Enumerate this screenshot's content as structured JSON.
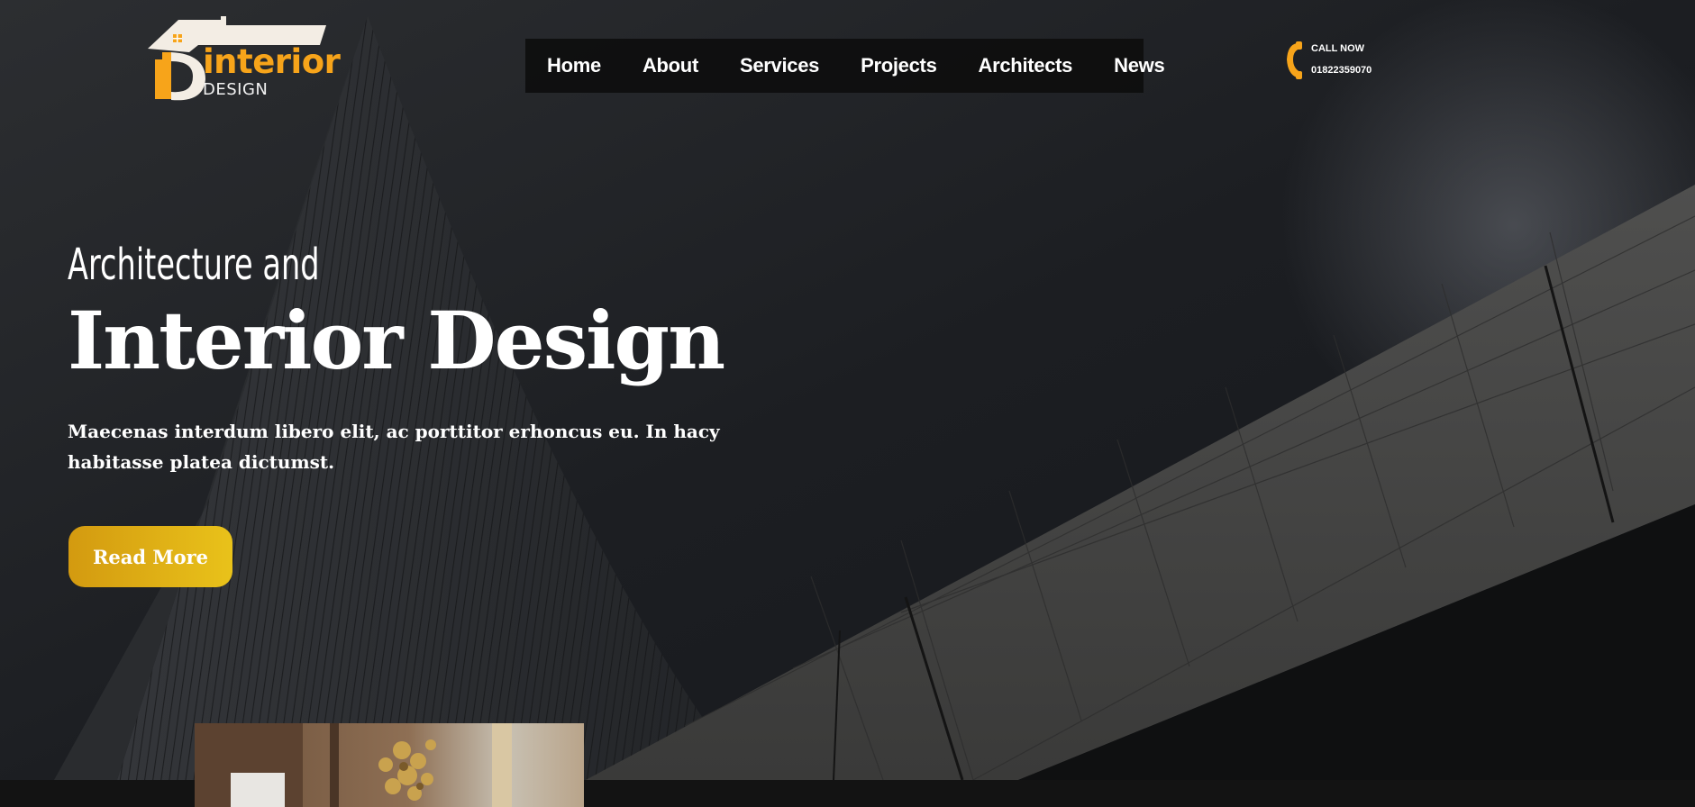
{
  "brand": {
    "logo_letters": "iD",
    "logo_word": "interior",
    "logo_sub": "DESIGN",
    "accent": "#f7a41a"
  },
  "nav": {
    "items": [
      {
        "label": "Home"
      },
      {
        "label": "About"
      },
      {
        "label": "Services"
      },
      {
        "label": "Projects"
      },
      {
        "label": "Architects"
      },
      {
        "label": "News"
      }
    ]
  },
  "call": {
    "label": "CALL NOW",
    "number": "01822359070",
    "icon": "phone-icon"
  },
  "hero": {
    "subtitle": "Architecture and",
    "title": "Interior Design",
    "description": "Maecenas interdum libero elit, ac porttitor erhoncus eu. In hacy habitasse platea dictumst.",
    "cta_label": "Read More",
    "cta_colors": [
      "#d39a10",
      "#e9c21a"
    ]
  }
}
